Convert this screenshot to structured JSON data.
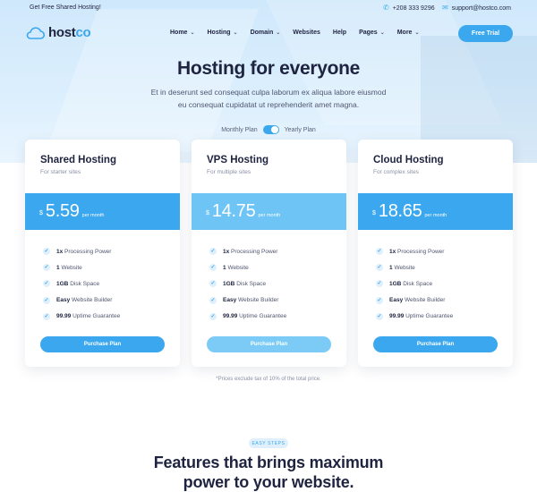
{
  "colors": {
    "accent": "#3aa7ee",
    "accent_light": "#7ccbf6",
    "heading": "#1e2340",
    "hero_bg": "#d6ecfc"
  },
  "topbar": {
    "promo": "Get Free Shared Hosting!",
    "phone": "+208 333 9296",
    "email": "support@hostco.com",
    "phone_icon": "phone-icon",
    "email_icon": "mail-icon"
  },
  "logo": {
    "host": "host",
    "co": "co",
    "icon": "cloud-icon"
  },
  "nav": {
    "items": [
      {
        "label": "Home",
        "dropdown": true
      },
      {
        "label": "Hosting",
        "dropdown": true
      },
      {
        "label": "Domain",
        "dropdown": true
      },
      {
        "label": "Websites",
        "dropdown": false
      },
      {
        "label": "Help",
        "dropdown": false
      },
      {
        "label": "Pages",
        "dropdown": true
      },
      {
        "label": "More",
        "dropdown": true
      }
    ],
    "cta": "Free Trial"
  },
  "hero": {
    "title": "Hosting for everyone",
    "subtitle": "Et in deserunt sed consequat culpa laborum ex aliqua labore eiusmod eu consequat cupidatat ut reprehenderit amet magna."
  },
  "billing_toggle": {
    "monthly": "Monthly Plan",
    "yearly": "Yearly Plan",
    "state": "yearly"
  },
  "plans": [
    {
      "name": "Shared Hosting",
      "for": "For starter sites",
      "currency": "$",
      "price": "5.59",
      "period": "per month",
      "features": [
        {
          "strong": "1x",
          "text": "Processing Power"
        },
        {
          "strong": "1",
          "text": "Website"
        },
        {
          "strong": "1GB",
          "text": "Disk Space"
        },
        {
          "strong": "Easy",
          "text": "Website Builder"
        },
        {
          "strong": "99.99",
          "text": "Uptime Guarantee"
        }
      ],
      "button": "Purchase Plan"
    },
    {
      "name": "VPS Hosting",
      "for": "For multiple sites",
      "currency": "$",
      "price": "14.75",
      "period": "per month",
      "features": [
        {
          "strong": "1x",
          "text": "Processing Power"
        },
        {
          "strong": "1",
          "text": "Website"
        },
        {
          "strong": "1GB",
          "text": "Disk Space"
        },
        {
          "strong": "Easy",
          "text": "Website Builder"
        },
        {
          "strong": "99.99",
          "text": "Uptime Guarantee"
        }
      ],
      "button": "Purchase Plan"
    },
    {
      "name": "Cloud Hosting",
      "for": "For complex sites",
      "currency": "$",
      "price": "18.65",
      "period": "per month",
      "features": [
        {
          "strong": "1x",
          "text": "Processing Power"
        },
        {
          "strong": "1",
          "text": "Website"
        },
        {
          "strong": "1GB",
          "text": "Disk Space"
        },
        {
          "strong": "Easy",
          "text": "Website Builder"
        },
        {
          "strong": "99.99",
          "text": "Uptime Guarantee"
        }
      ],
      "button": "Purchase Plan"
    }
  ],
  "tax_note": "*Prices exclude tax of 10% of the total price.",
  "steps": {
    "badge": "EASY STEPS",
    "title_line1": "Features that brings maximum",
    "title_line2": "power to your website."
  }
}
